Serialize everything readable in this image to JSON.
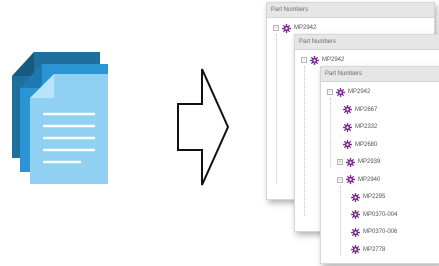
{
  "panels": [
    {
      "header": "Part Numbers",
      "rows": [
        {
          "label": "MP2942",
          "toggle": "−"
        }
      ]
    },
    {
      "header": "Part Numbers",
      "rows": [
        {
          "label": "MP2942",
          "toggle": "−"
        }
      ]
    },
    {
      "header": "Part Numbers",
      "rows": [
        {
          "label": "MP2942",
          "toggle": "−"
        },
        {
          "label": "MP2667",
          "toggle": ""
        },
        {
          "label": "MP2332",
          "toggle": ""
        },
        {
          "label": "MP2680",
          "toggle": ""
        },
        {
          "label": "MP2939",
          "toggle": "+"
        },
        {
          "label": "MP2940",
          "toggle": "−"
        },
        {
          "label": "MP2295",
          "toggle": ""
        },
        {
          "label": "MP0370-004",
          "toggle": ""
        },
        {
          "label": "MP0370-006",
          "toggle": ""
        },
        {
          "label": "MP2778",
          "toggle": ""
        }
      ]
    }
  ],
  "icons": {
    "documents": "stacked-documents-icon",
    "arrow": "right-arrow-outline-icon",
    "node": "gear-icon"
  },
  "colors": {
    "doc_back": "#1f6f9c",
    "doc_mid": "#2b95d3",
    "doc_front": "#8fd0f3",
    "gear": "#7b2a8c"
  }
}
